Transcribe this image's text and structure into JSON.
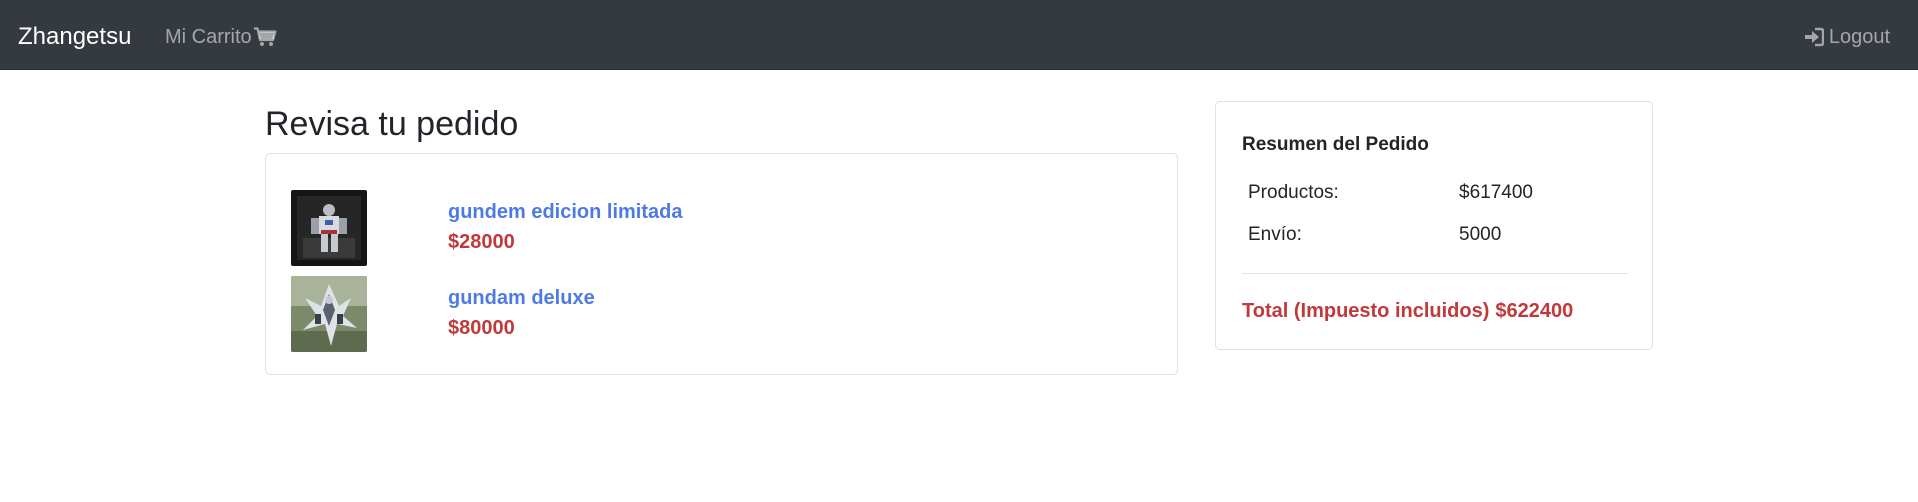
{
  "navbar": {
    "brand": "Zhangetsu",
    "cart_label": "Mi Carrito",
    "cart_icon": "shopping-cart-icon",
    "logout_label": "Logout",
    "logout_icon": "sign-in-icon",
    "background": "#343a40"
  },
  "page": {
    "title": "Revisa tu pedido"
  },
  "order": {
    "items": [
      {
        "name": "gundem edicion limitada",
        "price": "$28000"
      },
      {
        "name": "gundam deluxe",
        "price": "$80000"
      }
    ]
  },
  "summary": {
    "title": "Resumen del Pedido",
    "rows": [
      {
        "label": "Productos:",
        "value": "$617400"
      },
      {
        "label": "Envío:",
        "value": "5000"
      }
    ],
    "total_label": "Total (Impuesto incluidos)",
    "total_value": "$622400"
  },
  "colors": {
    "link": "#4f7ae6",
    "price": "#c0393b",
    "text": "#212529"
  }
}
